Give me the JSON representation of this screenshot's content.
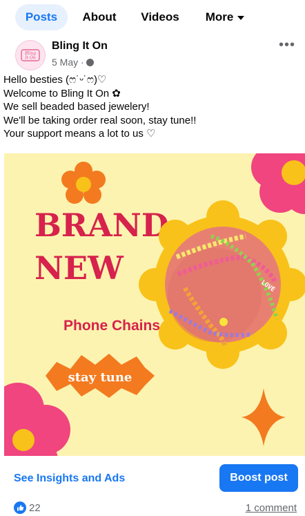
{
  "tabs": [
    {
      "label": "Posts"
    },
    {
      "label": "About"
    },
    {
      "label": "Videos"
    },
    {
      "label": "More"
    }
  ],
  "post": {
    "page_name": "Bling It On",
    "avatar_text": "Bling It On",
    "date": "5 May",
    "privacy_icon": "globe-icon",
    "text_lines": [
      "Hello besties (ෆ˙ᵕ˙ෆ)♡",
      "Welcome to Bling It On ✿",
      "We sell beaded based jewelery!",
      "We'll be taking order real soon, stay tune!!",
      "Your support means a lot to us ♡"
    ],
    "image": {
      "headline_line1": "BRAND",
      "headline_line2": "NEW",
      "subheadline": "Phone Chains",
      "badge_text": "stay tune",
      "bead_word": "LOVE",
      "background_color": "#fdf3b0",
      "headline_color": "#d6224c",
      "accent_orange": "#f37a1f",
      "flower_pink": "#f0457f",
      "flower_yellow": "#f8c21a"
    }
  },
  "actions": {
    "insights_label": "See Insights and Ads",
    "boost_label": "Boost post"
  },
  "footer": {
    "like_count": "22",
    "comments_label": "1 comment"
  },
  "colors": {
    "facebook_blue": "#1877f2",
    "secondary_text": "#65676b"
  }
}
